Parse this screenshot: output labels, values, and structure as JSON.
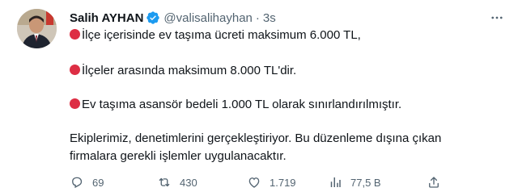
{
  "author": {
    "name": "Salih AYHAN",
    "handle": "@valisalihayhan",
    "separator": "·",
    "time": "3s"
  },
  "body": {
    "line1": "İlçe içerisinde ev taşıma ücreti maksimum 6.000 TL,",
    "line2": "İlçeler arasında maksimum 8.000 TL'dir.",
    "line3": "Ev taşıma asansör bedeli 1.000 TL olarak sınırlandırılmıştır.",
    "line4": "Ekiplerimiz, denetimlerini gerçekleştiriyor. Bu düzenleme dışına çıkan",
    "line5": "firmalara gerekli işlemler uygulanacaktır."
  },
  "actions": {
    "replies": "69",
    "retweets": "430",
    "likes": "1.719",
    "views": "77,5 B"
  },
  "icons": {
    "verified": "verified-badge-icon",
    "more": "more-options-icon",
    "bullet": "red-circle-emoji",
    "reply": "reply-icon",
    "retweet": "retweet-icon",
    "like": "heart-icon",
    "views": "views-chart-icon",
    "share": "share-icon"
  },
  "colors": {
    "verified": "#1d9bf0",
    "bullet": "#dd2e44",
    "secondary_text": "#536471",
    "primary_text": "#0f1419"
  }
}
